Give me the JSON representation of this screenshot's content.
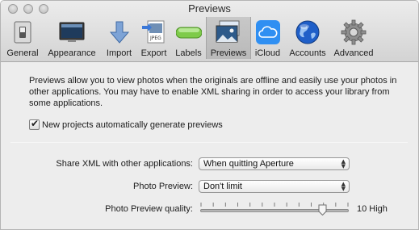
{
  "window": {
    "title": "Previews"
  },
  "toolbar": {
    "selected": "Previews",
    "items": [
      {
        "label": "General",
        "icon": "general-switch-icon"
      },
      {
        "label": "Appearance",
        "icon": "monitor-icon"
      },
      {
        "label": "Import",
        "icon": "import-arrow-icon"
      },
      {
        "label": "Export",
        "icon": "export-jpeg-icon"
      },
      {
        "label": "Labels",
        "icon": "label-pill-icon"
      },
      {
        "label": "Previews",
        "icon": "preview-image-icon"
      },
      {
        "label": "iCloud",
        "icon": "icloud-icon"
      },
      {
        "label": "Accounts",
        "icon": "globe-icon"
      },
      {
        "label": "Advanced",
        "icon": "gear-icon"
      }
    ]
  },
  "content": {
    "description": "Previews allow you to view photos when the originals are offline and easily use your photos in other applications. You may have to enable XML sharing in order to access your library from some applications.",
    "auto_previews": {
      "label": "New projects automatically generate previews",
      "checked": true
    },
    "share_xml": {
      "label": "Share XML with other applications:",
      "value": "When quitting Aperture"
    },
    "photo_preview": {
      "label": "Photo Preview:",
      "value": "Don't limit"
    },
    "quality": {
      "label": "Photo Preview quality:",
      "value_text": "10 High",
      "level": 10,
      "min": 0,
      "max": 12
    }
  },
  "colors": {
    "selected_tab": "#bdbdbd",
    "icloud": "#2f8ff2",
    "labels_pill": "#7ecb4a"
  }
}
